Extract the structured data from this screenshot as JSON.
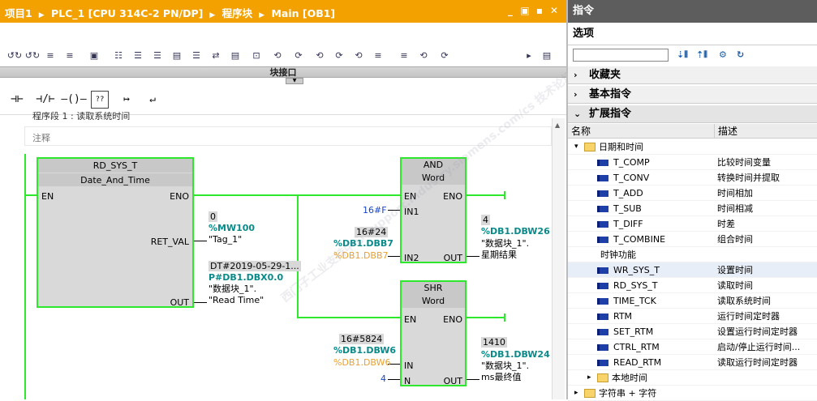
{
  "editor": {
    "breadcrumb": [
      "项目1",
      "PLC_1 [CPU 314C-2 PN/DP]",
      "程序块",
      "Main [OB1]"
    ],
    "window_controls": [
      "_",
      "▣",
      "▪",
      "✕"
    ],
    "toolbar_icons": [
      "↺↻",
      "↺↻",
      "≡",
      "≡",
      "▣",
      "☷",
      "☰",
      "☰",
      "▤",
      "☰",
      "⇄",
      "▤",
      "⊡",
      "⟲",
      "⟳",
      "⟲",
      "⟳",
      "⟲",
      "≡",
      "≡",
      "⟲",
      "⟳",
      "▸",
      "▤"
    ],
    "block_interface_label": "块接口",
    "ladder_buttons": [
      "⊣⊢",
      "⊣/⊢",
      "–()–",
      "??",
      "↦",
      "↵"
    ],
    "segment_title": "程序段 1 :   读取系统时间",
    "comment_label": "注释",
    "watermark": "西门子工业支持中心 support.industry.siemens.com/cs  技术论坛",
    "blocks": {
      "rd_sys_t": {
        "name": "RD_SYS_T",
        "type": "Date_And_Time",
        "pin_en": "EN",
        "pin_eno": "ENO",
        "pin_ret": "RET_VAL",
        "pin_out": "OUT"
      },
      "and_block": {
        "name": "AND",
        "type": "Word",
        "pin_en": "EN",
        "pin_eno": "ENO",
        "pin_in1": "IN1",
        "pin_in2": "IN2",
        "pin_out": "OUT"
      },
      "shr_block": {
        "name": "SHR",
        "type": "Word",
        "pin_en": "EN",
        "pin_eno": "ENO",
        "pin_in": "IN",
        "pin_n": "N",
        "pin_out": "OUT"
      }
    },
    "values": {
      "ret_val_live": "0",
      "ret_val_addr": "%MW100",
      "ret_val_tag": "\"Tag_1\"",
      "out_live": "DT#2019-05-29-1...",
      "out_addr": "P#DB1.DBX0.0",
      "out_tag1": "\"数据块_1\".",
      "out_tag2": "\"Read Time\"",
      "and_in1": "16#F",
      "and_in2_live": "16#24",
      "and_in2_addr": "%DB1.DBB7",
      "and_in2_sym": "%DB1.DBB7",
      "and_out_live": "4",
      "and_out_addr": "%DB1.DBW26",
      "and_out_tag1": "\"数据块_1\".",
      "and_out_tag2": "星期结果",
      "shr_in_live": "16#5824",
      "shr_in_addr": "%DB1.DBW6",
      "shr_in_sym": "%DB1.DBW6",
      "shr_n": "4",
      "shr_out_live": "1410",
      "shr_out_addr": "%DB1.DBW24",
      "shr_out_tag1": "\"数据块_1\".",
      "shr_out_tag2": "ms最终值"
    }
  },
  "instructions": {
    "title": "指令",
    "options_label": "选项",
    "search_value": "",
    "categories": [
      {
        "label": "收藏夹",
        "arrow": "›"
      },
      {
        "label": "基本指令",
        "arrow": "›"
      },
      {
        "label": "扩展指令",
        "arrow": "⌄"
      }
    ],
    "columns": {
      "name": "名称",
      "desc": "描述"
    },
    "rows": [
      {
        "kind": "folder",
        "name": "日期和时间",
        "desc": "",
        "open": true
      },
      {
        "kind": "fn",
        "name": "T_COMP",
        "desc": "比较时间变量"
      },
      {
        "kind": "fn",
        "name": "T_CONV",
        "desc": "转换时间并提取"
      },
      {
        "kind": "fn",
        "name": "T_ADD",
        "desc": "时间相加"
      },
      {
        "kind": "fn",
        "name": "T_SUB",
        "desc": "时间相减"
      },
      {
        "kind": "fn",
        "name": "T_DIFF",
        "desc": "时差"
      },
      {
        "kind": "fn",
        "name": "T_COMBINE",
        "desc": "组合时间"
      },
      {
        "kind": "group",
        "name": "时钟功能",
        "desc": ""
      },
      {
        "kind": "fn",
        "name": "WR_SYS_T",
        "desc": "设置时间"
      },
      {
        "kind": "fn",
        "name": "RD_SYS_T",
        "desc": "读取时间"
      },
      {
        "kind": "fn",
        "name": "TIME_TCK",
        "desc": "读取系统时间"
      },
      {
        "kind": "fn",
        "name": "RTM",
        "desc": "运行时间定时器"
      },
      {
        "kind": "fn",
        "name": "SET_RTM",
        "desc": "设置运行时间定时器"
      },
      {
        "kind": "fn",
        "name": "CTRL_RTM",
        "desc": "启动/停止运行时间..."
      },
      {
        "kind": "fn",
        "name": "READ_RTM",
        "desc": "读取运行时间定时器"
      },
      {
        "kind": "folder",
        "name": "本地时间",
        "desc": "",
        "open": false
      },
      {
        "kind": "folder",
        "name": "字符串 + 字符",
        "desc": "",
        "open": false
      }
    ]
  }
}
